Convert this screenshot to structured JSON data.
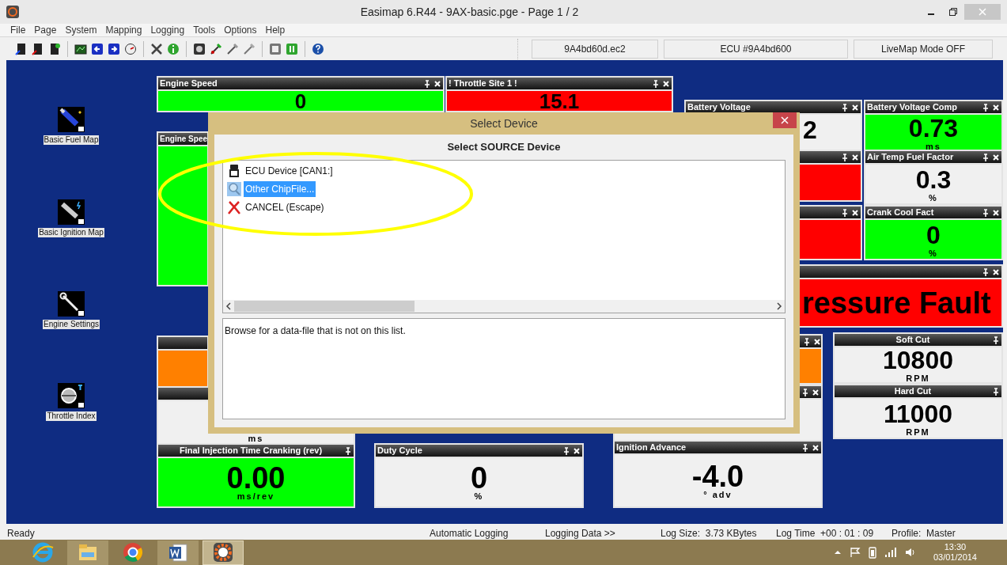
{
  "window": {
    "title": "Easimap 6.R44 - 9AX-basic.pge - Page 1 / 2"
  },
  "menu": [
    "File",
    "Page",
    "System",
    "Mapping",
    "Logging",
    "Tools",
    "Options",
    "Help"
  ],
  "toolbar_fields": [
    "9A4bd60d.ec2",
    "ECU #9A4bd600",
    "LiveMap Mode OFF"
  ],
  "shortcuts": [
    {
      "label": "Basic Fuel Map",
      "kind": "fuel"
    },
    {
      "label": "Basic Ignition Map",
      "kind": "ignition"
    },
    {
      "label": "Engine Settings",
      "kind": "settings"
    },
    {
      "label": "Throttle Index",
      "kind": "throttle"
    }
  ],
  "gauges": [
    {
      "title": "Engine Speed",
      "value": "0",
      "color": "#00ff00",
      "pin_button": true,
      "close_button": true
    },
    {
      "title": "! Throttle Site 1 !",
      "value": "15.1",
      "color": "#ff0000",
      "pin_button": true,
      "close_button": true
    },
    {
      "title": "Engine Spee",
      "color": "#00ff00",
      "pin_button": false,
      "close_button": false
    },
    {
      "title": "Battery Voltage",
      "value": "2",
      "color": "#f0f0f0",
      "pin_button": true,
      "close_button": true
    },
    {
      "color": "#ff0000",
      "pin_button": true,
      "close_button": true
    },
    {
      "title": "Battery Voltage Comp",
      "value": "0.73",
      "unit": "ms",
      "color": "#00ff00",
      "pin_button": true,
      "close_button": true
    },
    {
      "title": "Air Temp Fuel Factor",
      "value": "0.3",
      "unit": "%",
      "color": "#f0f0f0",
      "pin_button": true,
      "close_button": true
    },
    {
      "color": "#ff0000",
      "pin_button": true,
      "close_button": true
    },
    {
      "title": "Crank Cool Fact",
      "value": "0",
      "unit": "%",
      "color": "#00ff00",
      "pin_button": true,
      "close_button": true
    },
    {
      "value": "ressure Fault",
      "color": "#ff0000",
      "pin_button": true,
      "close_button": true
    },
    {
      "color": "#ff8000",
      "pin_button": false,
      "close_button": false
    },
    {
      "unit": "ms",
      "color": "#f0f0f0",
      "pin_button": false,
      "close_button": false
    },
    {
      "color": "#ff8000",
      "pin_button": true,
      "close_button": true
    },
    {
      "color": "#f0f0f0",
      "pin_button": true,
      "close_button": true
    },
    {
      "title": "Soft Cut",
      "value": "10800",
      "unit": "RPM",
      "color": "#f0f0f0",
      "pin_button": true,
      "close_button": false
    },
    {
      "title": "Hard Cut",
      "value": "11000",
      "unit": "RPM",
      "color": "#f0f0f0",
      "pin_button": true,
      "close_button": false
    },
    {
      "title": "Final Injection Time Cranking (rev)",
      "value": "0.00",
      "unit": "ms/rev",
      "color": "#00ff00",
      "pin_button": true,
      "close_button": false
    },
    {
      "title": "Duty Cycle",
      "value": "0",
      "unit": "%",
      "color": "#f0f0f0",
      "pin_button": true,
      "close_button": true
    },
    {
      "title": "Ignition Advance",
      "value": "-4.0",
      "unit": "° adv",
      "color": "#f0f0f0",
      "pin_button": true,
      "close_button": true
    }
  ],
  "dialog": {
    "title": "Select Device",
    "heading": "Select SOURCE Device",
    "items": [
      {
        "label": "ECU Device [CAN1:]",
        "kind": "ecu",
        "selected": false
      },
      {
        "label": "Other ChipFile...",
        "kind": "browse",
        "selected": true
      },
      {
        "label": "CANCEL (Escape)",
        "kind": "cancel",
        "selected": false
      }
    ],
    "description": "Browse for a data-file that is not on this list."
  },
  "status_bar": [
    "Ready",
    "Automatic Logging",
    "Logging Data >>",
    "Log Size:  3.73 KBytes",
    "Log Time  +00 : 01 : 09",
    "Profile:  Master"
  ],
  "taskbar": {
    "apps": [
      {
        "kind": "ie",
        "running": false,
        "selected": false
      },
      {
        "kind": "explorer",
        "running": true,
        "selected": false
      },
      {
        "kind": "chrome",
        "running": false,
        "selected": false
      },
      {
        "kind": "word",
        "running": true,
        "selected": false
      },
      {
        "kind": "easimap",
        "running": true,
        "selected": true
      }
    ],
    "time": "13:30",
    "date": "03/01/2014"
  }
}
